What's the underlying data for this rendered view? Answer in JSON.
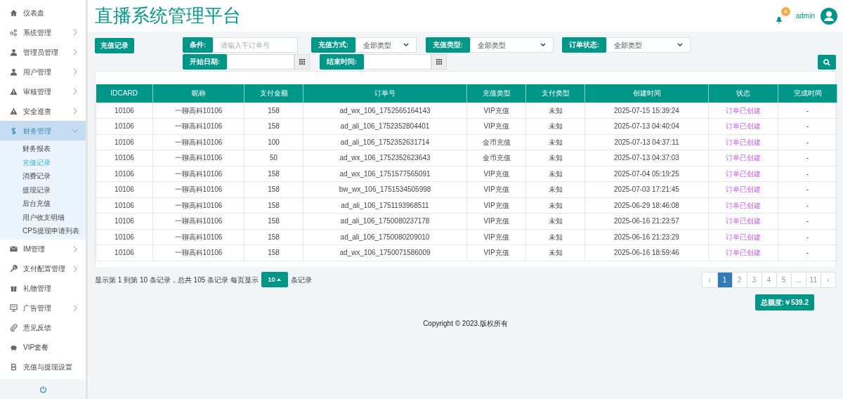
{
  "header": {
    "title": "直播系统管理平台",
    "notification_count": "4",
    "user": "admin"
  },
  "sidebar": {
    "items": [
      {
        "label": "仪表盘",
        "has_children": false,
        "expanded": false,
        "selected": false
      },
      {
        "label": "系统管理",
        "has_children": true,
        "expanded": false,
        "selected": false
      },
      {
        "label": "管理员管理",
        "has_children": true,
        "expanded": false,
        "selected": false
      },
      {
        "label": "用户管理",
        "has_children": true,
        "expanded": false,
        "selected": false
      },
      {
        "label": "审核管理",
        "has_children": true,
        "expanded": false,
        "selected": false
      },
      {
        "label": "安全巡查",
        "has_children": true,
        "expanded": false,
        "selected": false
      },
      {
        "label": "财务管理",
        "has_children": true,
        "expanded": true,
        "selected": true,
        "children": [
          {
            "label": "财务报表",
            "selected": false
          },
          {
            "label": "充值记录",
            "selected": true
          },
          {
            "label": "消费记录",
            "selected": false
          },
          {
            "label": "提现记录",
            "selected": false
          },
          {
            "label": "后台充值",
            "selected": false
          },
          {
            "label": "用户收支明细",
            "selected": false
          },
          {
            "label": "CPS提现申请列表",
            "selected": false
          }
        ]
      },
      {
        "label": "IM管理",
        "has_children": true,
        "expanded": false,
        "selected": false
      },
      {
        "label": "支付配置管理",
        "has_children": true,
        "expanded": false,
        "selected": false
      },
      {
        "label": "礼物管理",
        "has_children": false,
        "expanded": false,
        "selected": false
      },
      {
        "label": "广告管理",
        "has_children": true,
        "expanded": false,
        "selected": false
      },
      {
        "label": "意见反馈",
        "has_children": false,
        "expanded": false,
        "selected": false
      },
      {
        "label": "VIP套餐",
        "has_children": false,
        "expanded": false,
        "selected": false
      },
      {
        "label": "充值与提现设置",
        "has_children": false,
        "expanded": false,
        "selected": false
      }
    ]
  },
  "page_button": "充值记录",
  "filters": [
    {
      "kind": "text",
      "label": "条件:",
      "placeholder": "请输入手订单号"
    },
    {
      "kind": "select",
      "label": "充值方式:",
      "value": "全部类型"
    },
    {
      "kind": "select",
      "label": "充值类型:",
      "value": "全部类型"
    },
    {
      "kind": "select",
      "label": "订单状态:",
      "value": "全部类型"
    },
    {
      "kind": "date",
      "label": "开始日期:"
    },
    {
      "kind": "date",
      "label": "结束时间:"
    }
  ],
  "table": {
    "columns": [
      "IDCARD",
      "昵称",
      "支付金额",
      "订单号",
      "充值类型",
      "支付类型",
      "创建时间",
      "状态",
      "完成时间"
    ],
    "rows": [
      [
        "10106",
        "一聊高科10106",
        "158",
        "ad_wx_106_1752565164143",
        "VIP充值",
        "未知",
        "2025-07-15 15:39:24",
        "订单已创建",
        "-"
      ],
      [
        "10106",
        "一聊高科10106",
        "158",
        "ad_ali_106_1752352804401",
        "VIP充值",
        "未知",
        "2025-07-13 04:40:04",
        "订单已创建",
        "-"
      ],
      [
        "10106",
        "一聊高科10106",
        "100",
        "ad_ali_106_1752352631714",
        "金币充值",
        "未知",
        "2025-07-13 04:37:11",
        "订单已创建",
        "-"
      ],
      [
        "10106",
        "一聊高科10106",
        "50",
        "ad_wx_106_1752352623643",
        "金币充值",
        "未知",
        "2025-07-13 04:37:03",
        "订单已创建",
        "-"
      ],
      [
        "10106",
        "一聊高科10106",
        "158",
        "ad_wx_106_1751577565091",
        "VIP充值",
        "未知",
        "2025-07-04 05:19:25",
        "订单已创建",
        "-"
      ],
      [
        "10106",
        "一聊高科10106",
        "158",
        "bw_wx_106_1751534505998",
        "VIP充值",
        "未知",
        "2025-07-03 17:21:45",
        "订单已创建",
        "-"
      ],
      [
        "10106",
        "一聊高科10106",
        "158",
        "ad_ali_106_1751193968511",
        "VIP充值",
        "未知",
        "2025-06-29 18:46:08",
        "订单已创建",
        "-"
      ],
      [
        "10106",
        "一聊高科10106",
        "158",
        "ad_ali_106_1750080237178",
        "VIP充值",
        "未知",
        "2025-06-16 21:23:57",
        "订单已创建",
        "-"
      ],
      [
        "10106",
        "一聊高科10106",
        "158",
        "ad_ali_106_1750080209010",
        "VIP充值",
        "未知",
        "2025-06-16 21:23:29",
        "订单已创建",
        "-"
      ],
      [
        "10106",
        "一聊高科10106",
        "158",
        "ad_wx_106_1750071586009",
        "VIP充值",
        "未知",
        "2025-06-16 18:59:46",
        "订单已创建",
        "-"
      ]
    ]
  },
  "pagination": {
    "info_before": "显示第 1 到第 10 条记录，总共 105 条记录 每页显示",
    "page_size": "10",
    "info_after": "条记录",
    "pages": [
      {
        "label": "‹",
        "selected": false
      },
      {
        "label": "1",
        "selected": true
      },
      {
        "label": "2",
        "selected": false
      },
      {
        "label": "3",
        "selected": false
      },
      {
        "label": "4",
        "selected": false
      },
      {
        "label": "5",
        "selected": false
      },
      {
        "label": "...",
        "selected": false
      },
      {
        "label": "11",
        "selected": false
      },
      {
        "label": "›",
        "selected": false
      }
    ]
  },
  "total_button": "总额度:￥539.2",
  "footer": "Copyright © 2023.版权所有"
}
